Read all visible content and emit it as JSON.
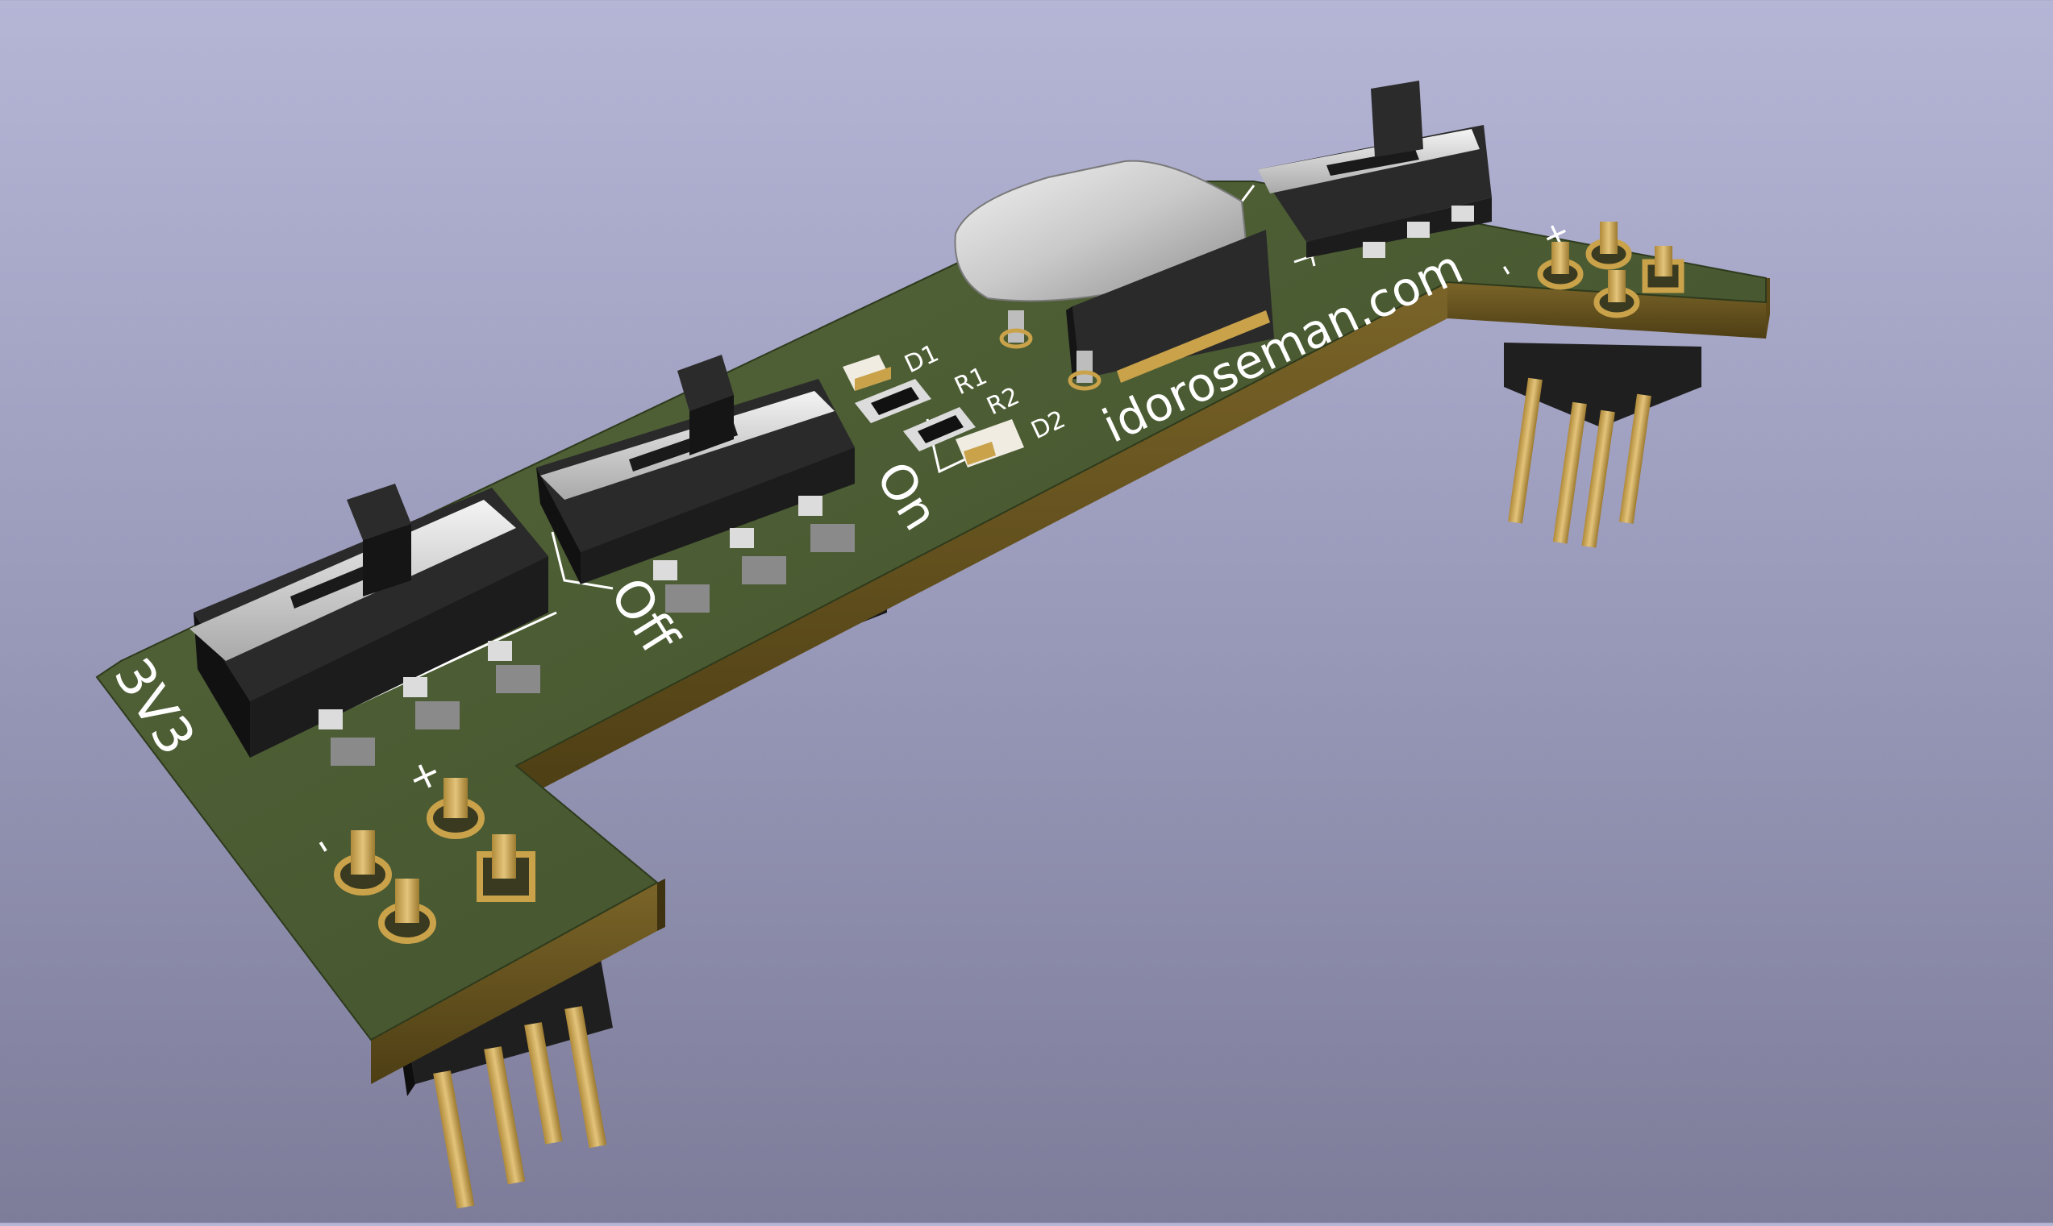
{
  "viewer": {
    "background_top": "#b5b5d6",
    "background_bottom": "#7d7d9a"
  },
  "board": {
    "pcb_color": "#4a5a30",
    "pcb_edge_color": "#6e5a22",
    "silkscreen_color": "#ffffff",
    "pad_color": "#c9a24a",
    "silkscreen": {
      "voltage_label": "3V3",
      "switch_off_label": "Off",
      "switch_on_label": "On",
      "led1_ref": "D1",
      "resistor1_ref": "R1",
      "resistor2_ref": "R2",
      "led2_ref": "D2",
      "website": "idoroseman.com",
      "left_minus": "-",
      "left_plus": "+",
      "right_minus": "-",
      "right_plus": "+"
    }
  }
}
